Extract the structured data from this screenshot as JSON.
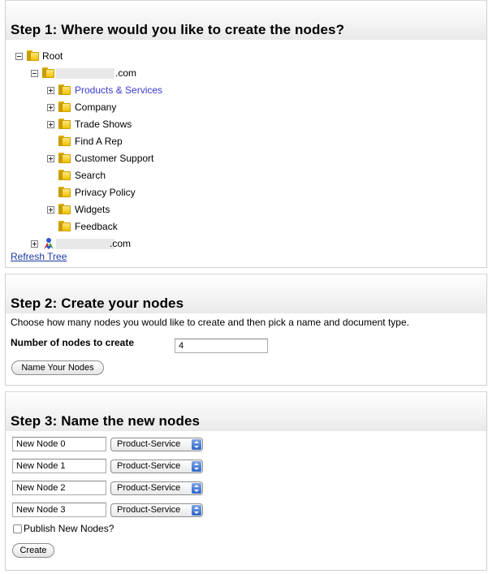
{
  "step1": {
    "title": "Step 1: Where would you like to create the nodes?",
    "tree": {
      "root": "Root",
      "site1_suffix": ".com",
      "site1_children": [
        {
          "label": "Products & Services",
          "expandable": true,
          "selected": true
        },
        {
          "label": "Company",
          "expandable": true
        },
        {
          "label": "Trade Shows",
          "expandable": true
        },
        {
          "label": "Find A Rep",
          "expandable": false
        },
        {
          "label": "Customer Support",
          "expandable": true
        },
        {
          "label": "Search",
          "expandable": false
        },
        {
          "label": "Privacy Policy",
          "expandable": false
        },
        {
          "label": "Widgets",
          "expandable": true
        },
        {
          "label": "Feedback",
          "expandable": false
        }
      ],
      "site2_suffix": ".com"
    },
    "refresh_link": "Refresh Tree"
  },
  "step2": {
    "title": "Step 2: Create your nodes",
    "instructions": "Choose how many nodes you would like to create and then pick a name and document type.",
    "count_label": "Number of nodes to create",
    "count_value": "4",
    "name_button": "Name Your Nodes"
  },
  "step3": {
    "title": "Step 3: Name the new nodes",
    "nodes": [
      {
        "name": "New Node 0",
        "type": "Product-Service"
      },
      {
        "name": "New Node 1",
        "type": "Product-Service"
      },
      {
        "name": "New Node 2",
        "type": "Product-Service"
      },
      {
        "name": "New Node 3",
        "type": "Product-Service"
      }
    ],
    "publish_label": "Publish New Nodes?",
    "publish_checked": false,
    "create_button": "Create"
  },
  "colors": {
    "link_blue": "#1a3aa0",
    "selected_item": "#3a3ad1",
    "folder_yellow": "#f2c200"
  }
}
